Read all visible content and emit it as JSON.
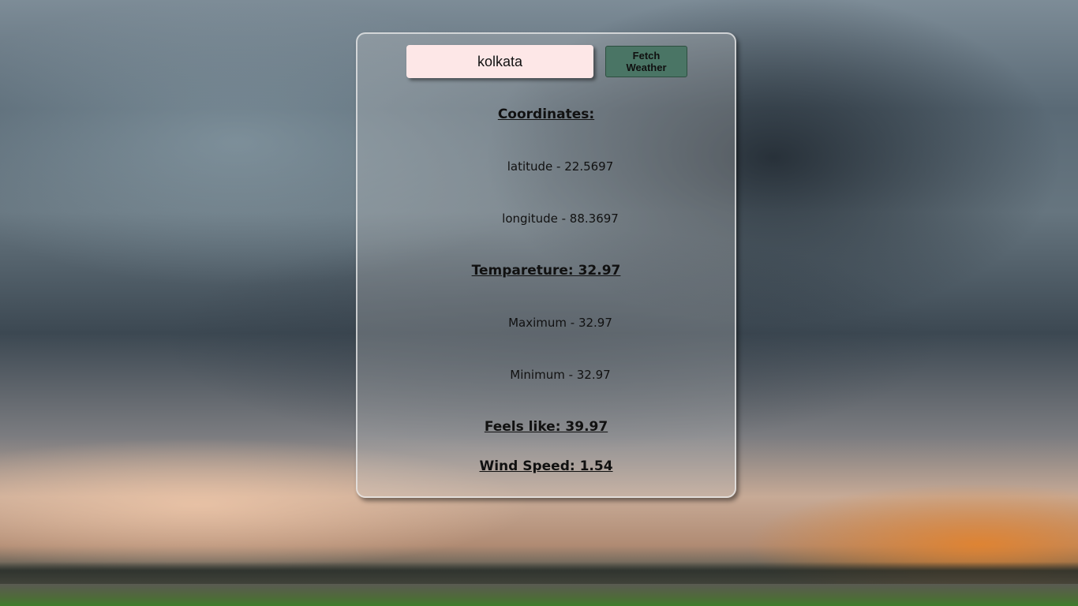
{
  "search": {
    "city_value": "kolkata",
    "fetch_label": "Fetch Weather"
  },
  "coordinates": {
    "heading": "Coordinates:",
    "latitude": "latitude - 22.5697",
    "longitude": "longitude - 88.3697"
  },
  "temperature": {
    "heading": "Tempareture: 32.97",
    "maximum": "Maximum - 32.97",
    "minimum": "Minimum - 32.97"
  },
  "feels_like": "Feels like: 39.97",
  "wind_speed": "Wind Speed: 1.54"
}
